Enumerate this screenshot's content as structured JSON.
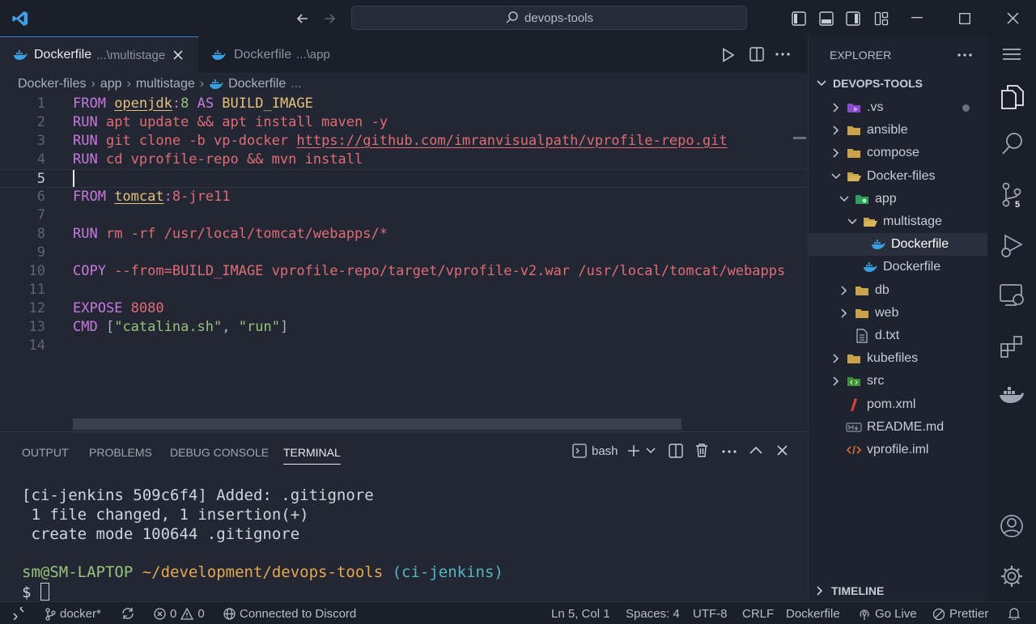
{
  "titlebar": {
    "search_text": "devops-tools"
  },
  "tabs": [
    {
      "label": "Dockerfile",
      "path": "...\\multistage"
    },
    {
      "label": "Dockerfile",
      "path": "...\\app"
    }
  ],
  "breadcrumb": [
    "Docker-files",
    "app",
    "multistage",
    "Dockerfile",
    "..."
  ],
  "editor": {
    "current_line": 5,
    "lines": [
      {
        "num": "1",
        "parts": [
          [
            "kw",
            "FROM "
          ],
          [
            "yel ul-y",
            "openjdk"
          ],
          [
            "kw",
            ":"
          ],
          [
            "grn",
            "8"
          ],
          [
            "kw",
            " AS "
          ],
          [
            "yel",
            "BUILD_IMAGE"
          ]
        ]
      },
      {
        "num": "2",
        "parts": [
          [
            "kw",
            "RUN "
          ],
          [
            "str",
            "apt update && apt install maven -y"
          ]
        ]
      },
      {
        "num": "3",
        "parts": [
          [
            "kw",
            "RUN "
          ],
          [
            "str",
            "git clone -b vp-docker "
          ],
          [
            "str ul",
            "https://github.com/imranvisualpath/vprofile-repo.git"
          ]
        ]
      },
      {
        "num": "4",
        "parts": [
          [
            "kw",
            "RUN "
          ],
          [
            "str",
            "cd vprofile-repo && mvn install"
          ]
        ]
      },
      {
        "num": "5",
        "parts": []
      },
      {
        "num": "6",
        "parts": [
          [
            "kw",
            "FROM "
          ],
          [
            "yel ul-y",
            "tomcat"
          ],
          [
            "kw",
            ":"
          ],
          [
            "str",
            "8-jre11"
          ]
        ]
      },
      {
        "num": "7",
        "parts": []
      },
      {
        "num": "8",
        "parts": [
          [
            "kw",
            "RUN "
          ],
          [
            "str",
            "rm -rf /usr/local/tomcat/webapps/*"
          ]
        ]
      },
      {
        "num": "9",
        "parts": []
      },
      {
        "num": "10",
        "parts": [
          [
            "kw",
            "COPY "
          ],
          [
            "str",
            "--from=BUILD_IMAGE vprofile-repo/target/vprofile-v2.war /usr/local/tomcat/webapps"
          ]
        ]
      },
      {
        "num": "11",
        "parts": []
      },
      {
        "num": "12",
        "parts": [
          [
            "kw",
            "EXPOSE "
          ],
          [
            "str",
            "8080"
          ]
        ]
      },
      {
        "num": "13",
        "parts": [
          [
            "kw",
            "CMD "
          ],
          [
            "wht",
            "["
          ],
          [
            "grn",
            "\"catalina.sh\""
          ],
          [
            "wht",
            ", "
          ],
          [
            "grn",
            "\"run\""
          ],
          [
            "wht",
            "]"
          ]
        ]
      },
      {
        "num": "14",
        "parts": []
      }
    ]
  },
  "panel": {
    "tabs": [
      "OUTPUT",
      "PROBLEMS",
      "DEBUG CONSOLE",
      "TERMINAL"
    ],
    "active_tab": "TERMINAL",
    "shell_label": "bash",
    "terminal": {
      "line1": "[ci-jenkins 509c6f4] Added: .gitignore",
      "line2": " 1 file changed, 1 insertion(+)",
      "line3": " create mode 100644 .gitignore",
      "prompt_user": "sm@SM-LAPTOP",
      "prompt_path": " ~/development/devops-tools",
      "prompt_branch": " (ci-jenkins)",
      "prompt_symbol": "$ "
    }
  },
  "explorer": {
    "header": "EXPLORER",
    "root": "DEVOPS-TOOLS",
    "items": [
      {
        "label": ".vs",
        "depth": 0,
        "chevron": "right",
        "icon": "vs-folder-icon",
        "dot": true
      },
      {
        "label": "ansible",
        "depth": 0,
        "chevron": "right",
        "icon": "folder-icon"
      },
      {
        "label": "compose",
        "depth": 0,
        "chevron": "right",
        "icon": "folder-icon"
      },
      {
        "label": "Docker-files",
        "depth": 0,
        "chevron": "down",
        "icon": "folder-open-icon"
      },
      {
        "label": "app",
        "depth": 1,
        "chevron": "down",
        "icon": "app-folder-icon"
      },
      {
        "label": "multistage",
        "depth": 2,
        "chevron": "down",
        "icon": "folder-open-icon"
      },
      {
        "label": "Dockerfile",
        "depth": 3,
        "chevron": "none",
        "icon": "docker-icon",
        "selected": true
      },
      {
        "label": "Dockerfile",
        "depth": 2,
        "chevron": "none",
        "icon": "docker-icon"
      },
      {
        "label": "db",
        "depth": 1,
        "chevron": "right",
        "icon": "folder-icon"
      },
      {
        "label": "web",
        "depth": 1,
        "chevron": "right",
        "icon": "folder-icon"
      },
      {
        "label": "d.txt",
        "depth": 1,
        "chevron": "none",
        "icon": "text-file-icon"
      },
      {
        "label": "kubefiles",
        "depth": 0,
        "chevron": "right",
        "icon": "folder-icon"
      },
      {
        "label": "src",
        "depth": 0,
        "chevron": "right",
        "icon": "src-folder-icon"
      },
      {
        "label": "pom.xml",
        "depth": 0,
        "chevron": "none",
        "icon": "maven-icon"
      },
      {
        "label": "README.md",
        "depth": 0,
        "chevron": "none",
        "icon": "markdown-icon"
      },
      {
        "label": "vprofile.iml",
        "depth": 0,
        "chevron": "none",
        "icon": "xml-icon"
      }
    ],
    "timeline": "TIMELINE"
  },
  "activity": {
    "scm_badge": "5"
  },
  "statusbar": {
    "branch": "docker*",
    "errors": "0",
    "warnings": "0",
    "discord": "Connected to Discord",
    "position": "Ln 5, Col 1",
    "spaces": "Spaces: 4",
    "encoding": "UTF-8",
    "eol": "CRLF",
    "language": "Dockerfile",
    "golive": "Go Live",
    "prettier": "Prettier"
  },
  "colors": {
    "accent": "#3f83d6",
    "keyword": "#c678dd",
    "string": "#e06c75",
    "type": "#e5c07b",
    "green": "#98c379"
  }
}
